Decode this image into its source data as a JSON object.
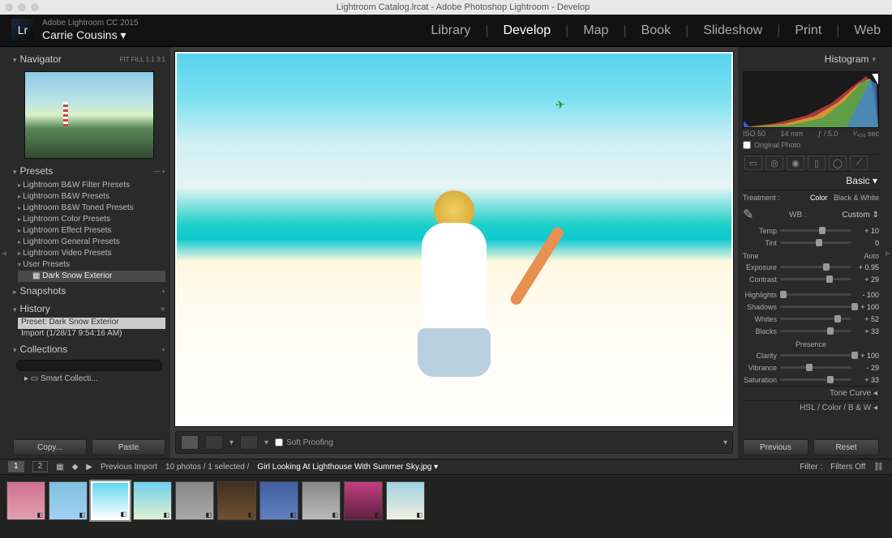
{
  "titlebar": "Lightroom Catalog.lrcat - Adobe Photoshop Lightroom - Develop",
  "brand": {
    "logo": "Lr",
    "line1": "Adobe Lightroom CC 2015",
    "user": "Carrie Cousins"
  },
  "modules": [
    "Library",
    "Develop",
    "Map",
    "Book",
    "Slideshow",
    "Print",
    "Web"
  ],
  "active_module": "Develop",
  "left": {
    "navigator": "Navigator",
    "nav_modes": "FIT  FILL  1:1  3:1",
    "presets": {
      "title": "Presets",
      "items": [
        "Lightroom B&W Filter Presets",
        "Lightroom B&W Presets",
        "Lightroom B&W Toned Presets",
        "Lightroom Color Presets",
        "Lightroom Effect Presets",
        "Lightroom General Presets",
        "Lightroom Video Presets",
        "User Presets"
      ],
      "open_item": "User Presets",
      "child": "Dark Snow Exterior"
    },
    "snapshots": "Snapshots",
    "history": {
      "title": "History",
      "items": [
        "Preset: Dark Snow Exterior",
        "Import (1/28/17 9:54:16 AM)"
      ]
    },
    "collections": {
      "title": "Collections",
      "item": "Smart Collecti..."
    },
    "copy": "Copy...",
    "paste": "Paste"
  },
  "center": {
    "soft_proofing": "Soft Proofing"
  },
  "right": {
    "histogram": "Histogram",
    "exif": {
      "iso": "ISO 50",
      "focal": "14 mm",
      "aperture": "ƒ / 5.0",
      "shutter": "¹⁄₄₀₀ sec"
    },
    "original": "Original Photo",
    "basic": "Basic",
    "treatment_label": "Treatment :",
    "treatment": [
      "Color",
      "Black & White"
    ],
    "wb": {
      "label": "WB :",
      "mode": "Custom"
    },
    "sliders": {
      "temp": {
        "label": "Temp",
        "value": "+ 10",
        "pos": 55
      },
      "tint": {
        "label": "Tint",
        "value": "0",
        "pos": 50
      },
      "tone_label": "Tone",
      "tone_auto": "Auto",
      "exposure": {
        "label": "Exposure",
        "value": "+ 0.95",
        "pos": 60
      },
      "contrast": {
        "label": "Contrast",
        "value": "+ 29",
        "pos": 65
      },
      "highlights": {
        "label": "Highlights",
        "value": "- 100",
        "pos": 0
      },
      "shadows": {
        "label": "Shadows",
        "value": "+ 100",
        "pos": 100
      },
      "whites": {
        "label": "Whites",
        "value": "+ 52",
        "pos": 76
      },
      "blacks": {
        "label": "Blacks",
        "value": "+ 33",
        "pos": 66
      },
      "presence_label": "Presence",
      "clarity": {
        "label": "Clarity",
        "value": "+ 100",
        "pos": 100
      },
      "vibrance": {
        "label": "Vibrance",
        "value": "- 29",
        "pos": 36
      },
      "saturation": {
        "label": "Saturation",
        "value": "+ 33",
        "pos": 66
      }
    },
    "tone_curve": "Tone Curve",
    "hsl": "HSL  /  Color  /  B & W",
    "previous": "Previous",
    "reset": "Reset"
  },
  "bottom": {
    "prev_import": "Previous Import",
    "count": "10 photos / 1 selected /",
    "filename": "Girl Looking At Lighthouse With Summer Sky.jpg",
    "filter_label": "Filter :",
    "filter_mode": "Filters Off"
  },
  "thumbs": [
    "linear-gradient(#d07090,#e0a0b0)",
    "linear-gradient(#80c0e0,#a0d0f0)",
    "linear-gradient(#60d8f0,#fff)",
    "linear-gradient(#70d0f0,#e0f0d0)",
    "linear-gradient(#888,#aaa)",
    "linear-gradient(#403020,#705030)",
    "linear-gradient(#4060a0,#6080c0)",
    "linear-gradient(#888,#bbb)",
    "linear-gradient(#c04080,#602040)",
    "linear-gradient(#a0d0e0,#f0f0e0)"
  ],
  "selected_thumb": 2
}
